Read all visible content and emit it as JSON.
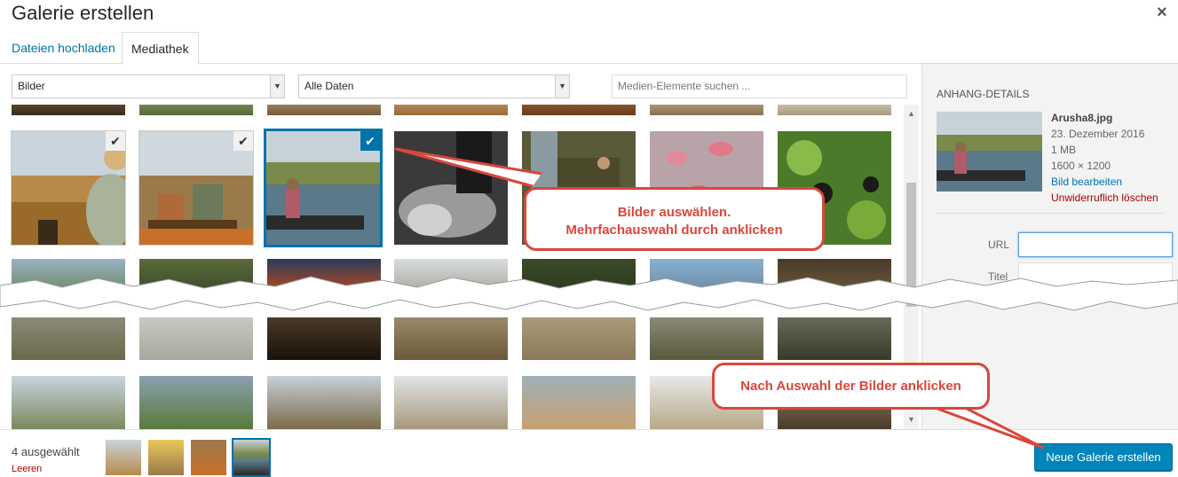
{
  "dialog": {
    "title": "Galerie erstellen",
    "close_glyph": "×"
  },
  "tabs": [
    {
      "label": "Dateien hochladen"
    },
    {
      "label": "Mediathek"
    }
  ],
  "filters": {
    "type": {
      "value": "Bilder"
    },
    "date": {
      "value": "Alle Daten"
    },
    "search": {
      "placeholder": "Medien-Elemente suchen ..."
    }
  },
  "sidebar": {
    "heading": "Anhang-Details",
    "filename": "Arusha8.jpg",
    "date": "23. Dezember 2016",
    "size": "1 MB",
    "dimensions": "1600 × 1200",
    "edit_link": "Bild bearbeiten",
    "delete_link": "Unwiderruflich löschen",
    "url_label": "URL",
    "title_label": "Titel"
  },
  "selection": {
    "count_label": "4 ausgewählt",
    "clear_label": "Leeren"
  },
  "primary_button": {
    "label": "Neue Galerie erstellen"
  },
  "annotations": {
    "callout_select": {
      "line1": "Bilder auswählen.",
      "line2": "Mehrfachauswahl durch anklicken"
    },
    "callout_create": {
      "text": "Nach Auswahl der Bilder anklicken"
    },
    "color": "#d9473c"
  },
  "icons": {
    "check": "checkmark-icon",
    "close": "close-icon",
    "dropdown": "chevron-down-icon"
  },
  "colors": {
    "accent": "#0073aa",
    "primary_button": "#0085ba",
    "danger": "#a00"
  }
}
